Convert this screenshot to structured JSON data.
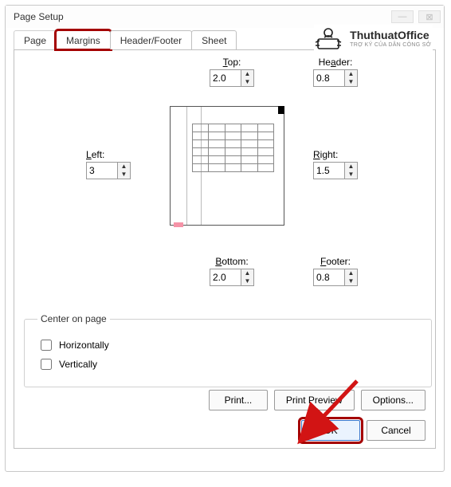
{
  "window": {
    "title": "Page Setup"
  },
  "tabs": {
    "page": "Page",
    "margins": "Margins",
    "header_footer": "Header/Footer",
    "sheet": "Sheet"
  },
  "margins": {
    "top_label": "Top:",
    "top_value": "2.0",
    "header_label": "Header:",
    "header_value": "0.8",
    "left_label": "Left:",
    "left_value": "3",
    "right_label": "Right:",
    "right_value": "1.5",
    "bottom_label": "Bottom:",
    "bottom_value": "2.0",
    "footer_label": "Footer:",
    "footer_value": "0.8"
  },
  "center": {
    "legend": "Center on page",
    "horizontally": "Horizontally",
    "vertically": "Vertically"
  },
  "buttons": {
    "print": "Print...",
    "preview": "Print Preview",
    "options": "Options...",
    "ok": "OK",
    "cancel": "Cancel"
  },
  "logo": {
    "line1": "ThuthuatOffice",
    "line2": "TRỢ KÝ CỦA DÂN CÔNG SỞ"
  }
}
